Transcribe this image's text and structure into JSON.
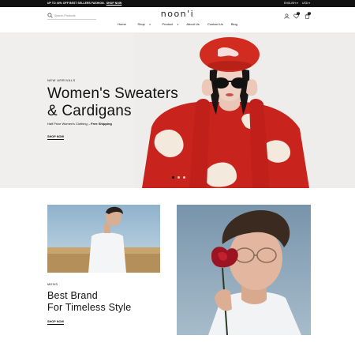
{
  "announcement": {
    "text": "UP TO 40% OFF BEST SELLERS FASHION.",
    "link": "SHOP NOW",
    "language": "ENGLISH",
    "currency": "USD"
  },
  "header": {
    "search_placeholder": "Search Products",
    "logo": "noon'i",
    "wishlist_count": "0",
    "cart_count": "0"
  },
  "nav": {
    "items": [
      "Home",
      "Shop",
      "Product",
      "About Us",
      "Contact Us",
      "Blog"
    ]
  },
  "hero": {
    "eyebrow": "NEW ARRIVALS",
    "title_line1": "Women's Sweaters",
    "title_line2": "& Cardigans",
    "subtitle": "Half Price Women's Clothing –",
    "subtitle_bold": "Free Shipping",
    "cta": "SHOP NOW",
    "slide_count": 3,
    "active_slide": 1
  },
  "promo": {
    "label": "MENS",
    "title_line1": "Best Brand",
    "title_line2": "For Timeless Style",
    "cta": "SHOP NOW"
  },
  "colors": {
    "topbar": "#111111",
    "hero_bg": "#f1efee",
    "beret_red": "#d22b20",
    "sweater_red": "#c8231c"
  }
}
